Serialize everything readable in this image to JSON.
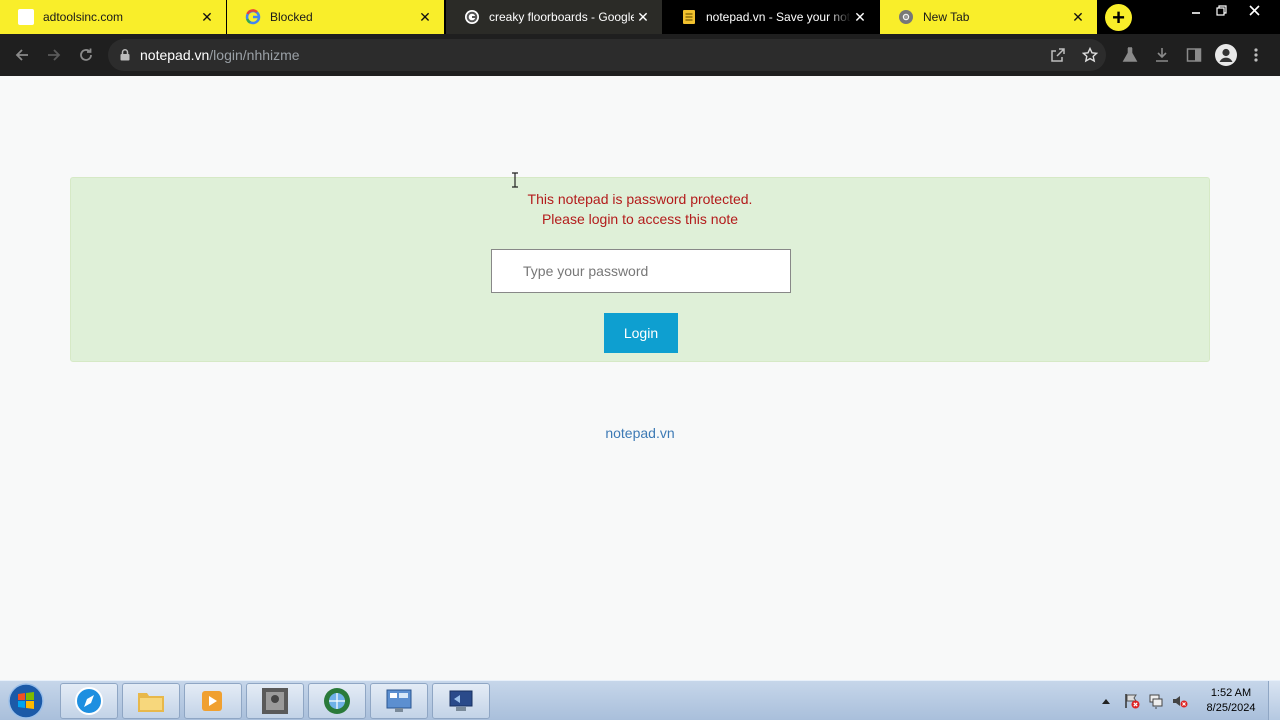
{
  "browser": {
    "tabs": [
      {
        "title": "adtoolsinc.com",
        "icon": "blank-page-icon",
        "style": "yellow"
      },
      {
        "title": "Blocked",
        "icon": "google-icon",
        "style": "yellow"
      },
      {
        "title": "creaky floorboards - Google",
        "icon": "google-icon",
        "style": "dark"
      },
      {
        "title": "notepad.vn - Save your note",
        "icon": "notepad-icon",
        "style": "active"
      },
      {
        "title": "New Tab",
        "icon": "chrome-icon",
        "style": "yellow"
      }
    ],
    "new_tab_label": "+",
    "url_host": "notepad.vn",
    "url_path": "/login/nhhizme"
  },
  "page": {
    "message_line1": "This notepad is password protected.",
    "message_line2": "Please login to access this note",
    "password_placeholder": "Type your password",
    "login_label": "Login",
    "footer_link": "notepad.vn"
  },
  "taskbar": {
    "time": "1:52 AM",
    "date": "8/25/2024",
    "items": [
      "safari-icon",
      "file-explorer-icon",
      "media-player-icon",
      "photo-app-icon",
      "browser-globe-icon",
      "control-panel-icon",
      "remote-desktop-icon"
    ]
  },
  "colors": {
    "accent_yellow": "#f9ee2a",
    "alert_bg": "#dff0d8",
    "alert_text": "#b31b1b",
    "login_button": "#0e9fd0",
    "link": "#3d7ab5"
  }
}
